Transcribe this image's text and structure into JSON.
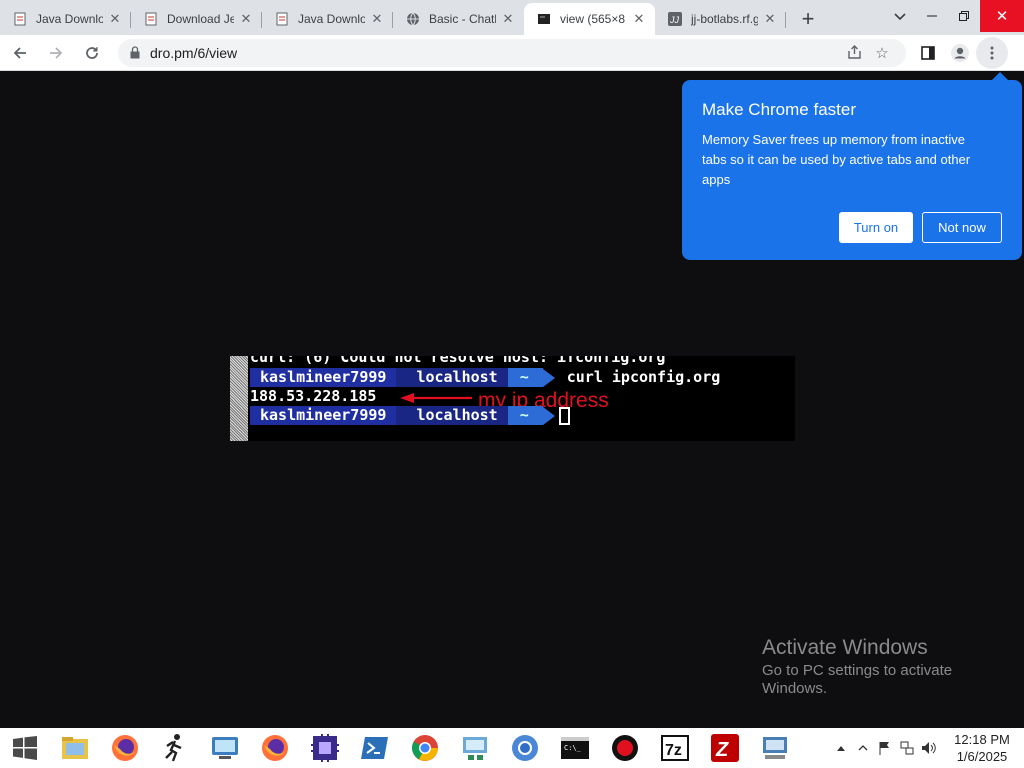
{
  "tabs": [
    {
      "title": "Java Downlo",
      "favicon": "doc-icon"
    },
    {
      "title": "Download Je",
      "favicon": "doc-icon"
    },
    {
      "title": "Java Downlo",
      "favicon": "doc-icon"
    },
    {
      "title": "Basic - Chath",
      "favicon": "globe-icon"
    },
    {
      "title": "view (565×8",
      "favicon": "image-icon",
      "active": true
    },
    {
      "title": "jj-botlabs.rf.g",
      "favicon": "jj-icon"
    }
  ],
  "toolbar": {
    "url": "dro.pm/6/view"
  },
  "terminal": {
    "line1": "curl: (6) Could not resolve host: ifconfig.org",
    "user": "kaslmineer7999",
    "host": "localhost",
    "dir": "~",
    "command": "curl ipconfig.org",
    "ip": "188.53.228.185",
    "annotation": "my ip address"
  },
  "popup": {
    "title": "Make Chrome faster",
    "body": "Memory Saver frees up memory from inactive tabs so it can be used by active tabs and other apps",
    "turn_on": "Turn on",
    "not_now": "Not now"
  },
  "watermark": {
    "title": "Activate Windows",
    "subtitle": "Go to PC settings to activate Windows."
  },
  "taskbar": {
    "time": "12:18 PM",
    "date": "1/6/2025",
    "apps": [
      "file-explorer-icon",
      "firefox-icon",
      "runner-icon",
      "monitor-icon",
      "firefox-icon",
      "chip-icon",
      "powershell-icon",
      "chrome-icon",
      "network-icon",
      "chromium-icon",
      "cmd-icon",
      "record-icon",
      "7zip-icon",
      "filezilla-icon",
      "remote-desktop-icon"
    ]
  },
  "colors": {
    "popup_bg": "#1a73e8",
    "annotation": "#e01020",
    "powerline_user": "#1f2ea0",
    "powerline_dir": "#2d6cd6"
  }
}
